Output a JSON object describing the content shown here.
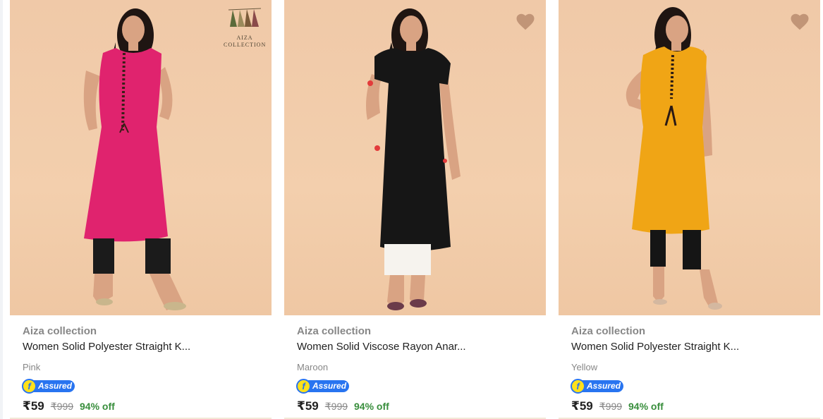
{
  "products": [
    {
      "brand": "Aiza collection",
      "title": "Women Solid Polyester Straight K...",
      "color": "Pink",
      "assured_label": "Assured",
      "price": "₹59",
      "mrp": "₹999",
      "discount": "94% off",
      "kurta_color": "#e0236e",
      "pant_color": "#1b1b1b",
      "has_logo": true,
      "logo_text": [
        "AIZA",
        "COLLECTION"
      ]
    },
    {
      "brand": "Aiza collection",
      "title": "Women Solid Viscose Rayon Anar...",
      "color": "Maroon",
      "assured_label": "Assured",
      "price": "₹59",
      "mrp": "₹999",
      "discount": "94% off",
      "kurta_color": "#161616",
      "pant_color": "#f6f3ee",
      "has_logo": false
    },
    {
      "brand": "Aiza collection",
      "title": "Women Solid Polyester Straight K...",
      "color": "Yellow",
      "assured_label": "Assured",
      "price": "₹59",
      "mrp": "₹999",
      "discount": "94% off",
      "kurta_color": "#f0a515",
      "pant_color": "#151515",
      "has_logo": false
    }
  ],
  "icons": {
    "wishlist": "heart-icon",
    "assured": "flipkart-assured-icon"
  },
  "colors": {
    "brand_gray": "#878787",
    "discount_green": "#388e3c",
    "assured_blue": "#2874f0",
    "image_bg": "#f0c9a8"
  }
}
